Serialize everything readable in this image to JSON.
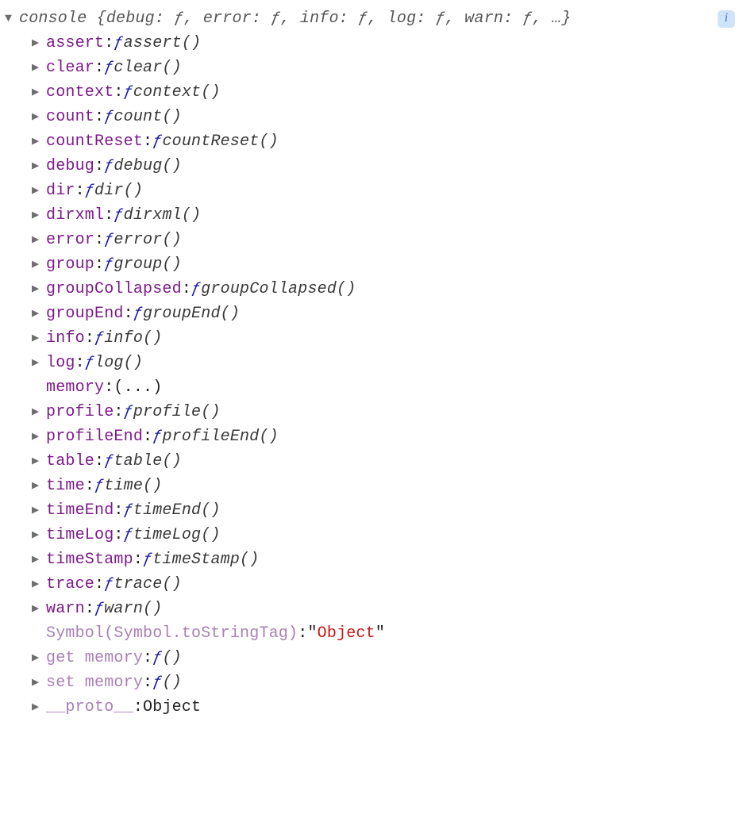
{
  "header": {
    "object_name": "console",
    "preview": "{debug: ƒ, error: ƒ, info: ƒ, log: ƒ, warn: ƒ, …}",
    "info_badge": "i"
  },
  "properties": [
    {
      "key": "assert",
      "type": "function",
      "fn_name": "assert()"
    },
    {
      "key": "clear",
      "type": "function",
      "fn_name": "clear()"
    },
    {
      "key": "context",
      "type": "function",
      "fn_name": "context()"
    },
    {
      "key": "count",
      "type": "function",
      "fn_name": "count()"
    },
    {
      "key": "countReset",
      "type": "function",
      "fn_name": "countReset()"
    },
    {
      "key": "debug",
      "type": "function",
      "fn_name": "debug()"
    },
    {
      "key": "dir",
      "type": "function",
      "fn_name": "dir()"
    },
    {
      "key": "dirxml",
      "type": "function",
      "fn_name": "dirxml()"
    },
    {
      "key": "error",
      "type": "function",
      "fn_name": "error()"
    },
    {
      "key": "group",
      "type": "function",
      "fn_name": "group()"
    },
    {
      "key": "groupCollapsed",
      "type": "function",
      "fn_name": "groupCollapsed()"
    },
    {
      "key": "groupEnd",
      "type": "function",
      "fn_name": "groupEnd()"
    },
    {
      "key": "info",
      "type": "function",
      "fn_name": "info()"
    },
    {
      "key": "log",
      "type": "function",
      "fn_name": "log()"
    },
    {
      "key": "memory",
      "type": "ellipsis",
      "value": "(...)"
    },
    {
      "key": "profile",
      "type": "function",
      "fn_name": "profile()"
    },
    {
      "key": "profileEnd",
      "type": "function",
      "fn_name": "profileEnd()"
    },
    {
      "key": "table",
      "type": "function",
      "fn_name": "table()"
    },
    {
      "key": "time",
      "type": "function",
      "fn_name": "time()"
    },
    {
      "key": "timeEnd",
      "type": "function",
      "fn_name": "timeEnd()"
    },
    {
      "key": "timeLog",
      "type": "function",
      "fn_name": "timeLog()"
    },
    {
      "key": "timeStamp",
      "type": "function",
      "fn_name": "timeStamp()"
    },
    {
      "key": "trace",
      "type": "function",
      "fn_name": "trace()"
    },
    {
      "key": "warn",
      "type": "function",
      "fn_name": "warn()"
    },
    {
      "key": "Symbol(Symbol.toStringTag)",
      "type": "string",
      "value": "Object",
      "dim": true
    },
    {
      "key": "get memory",
      "type": "function",
      "fn_name": "()",
      "dim": true
    },
    {
      "key": "set memory",
      "type": "function",
      "fn_name": "()",
      "dim": true
    },
    {
      "key": "__proto__",
      "type": "object",
      "value": "Object",
      "dim": true
    }
  ],
  "glyphs": {
    "expanded": "▼",
    "collapsed": "▶",
    "function": "ƒ"
  }
}
